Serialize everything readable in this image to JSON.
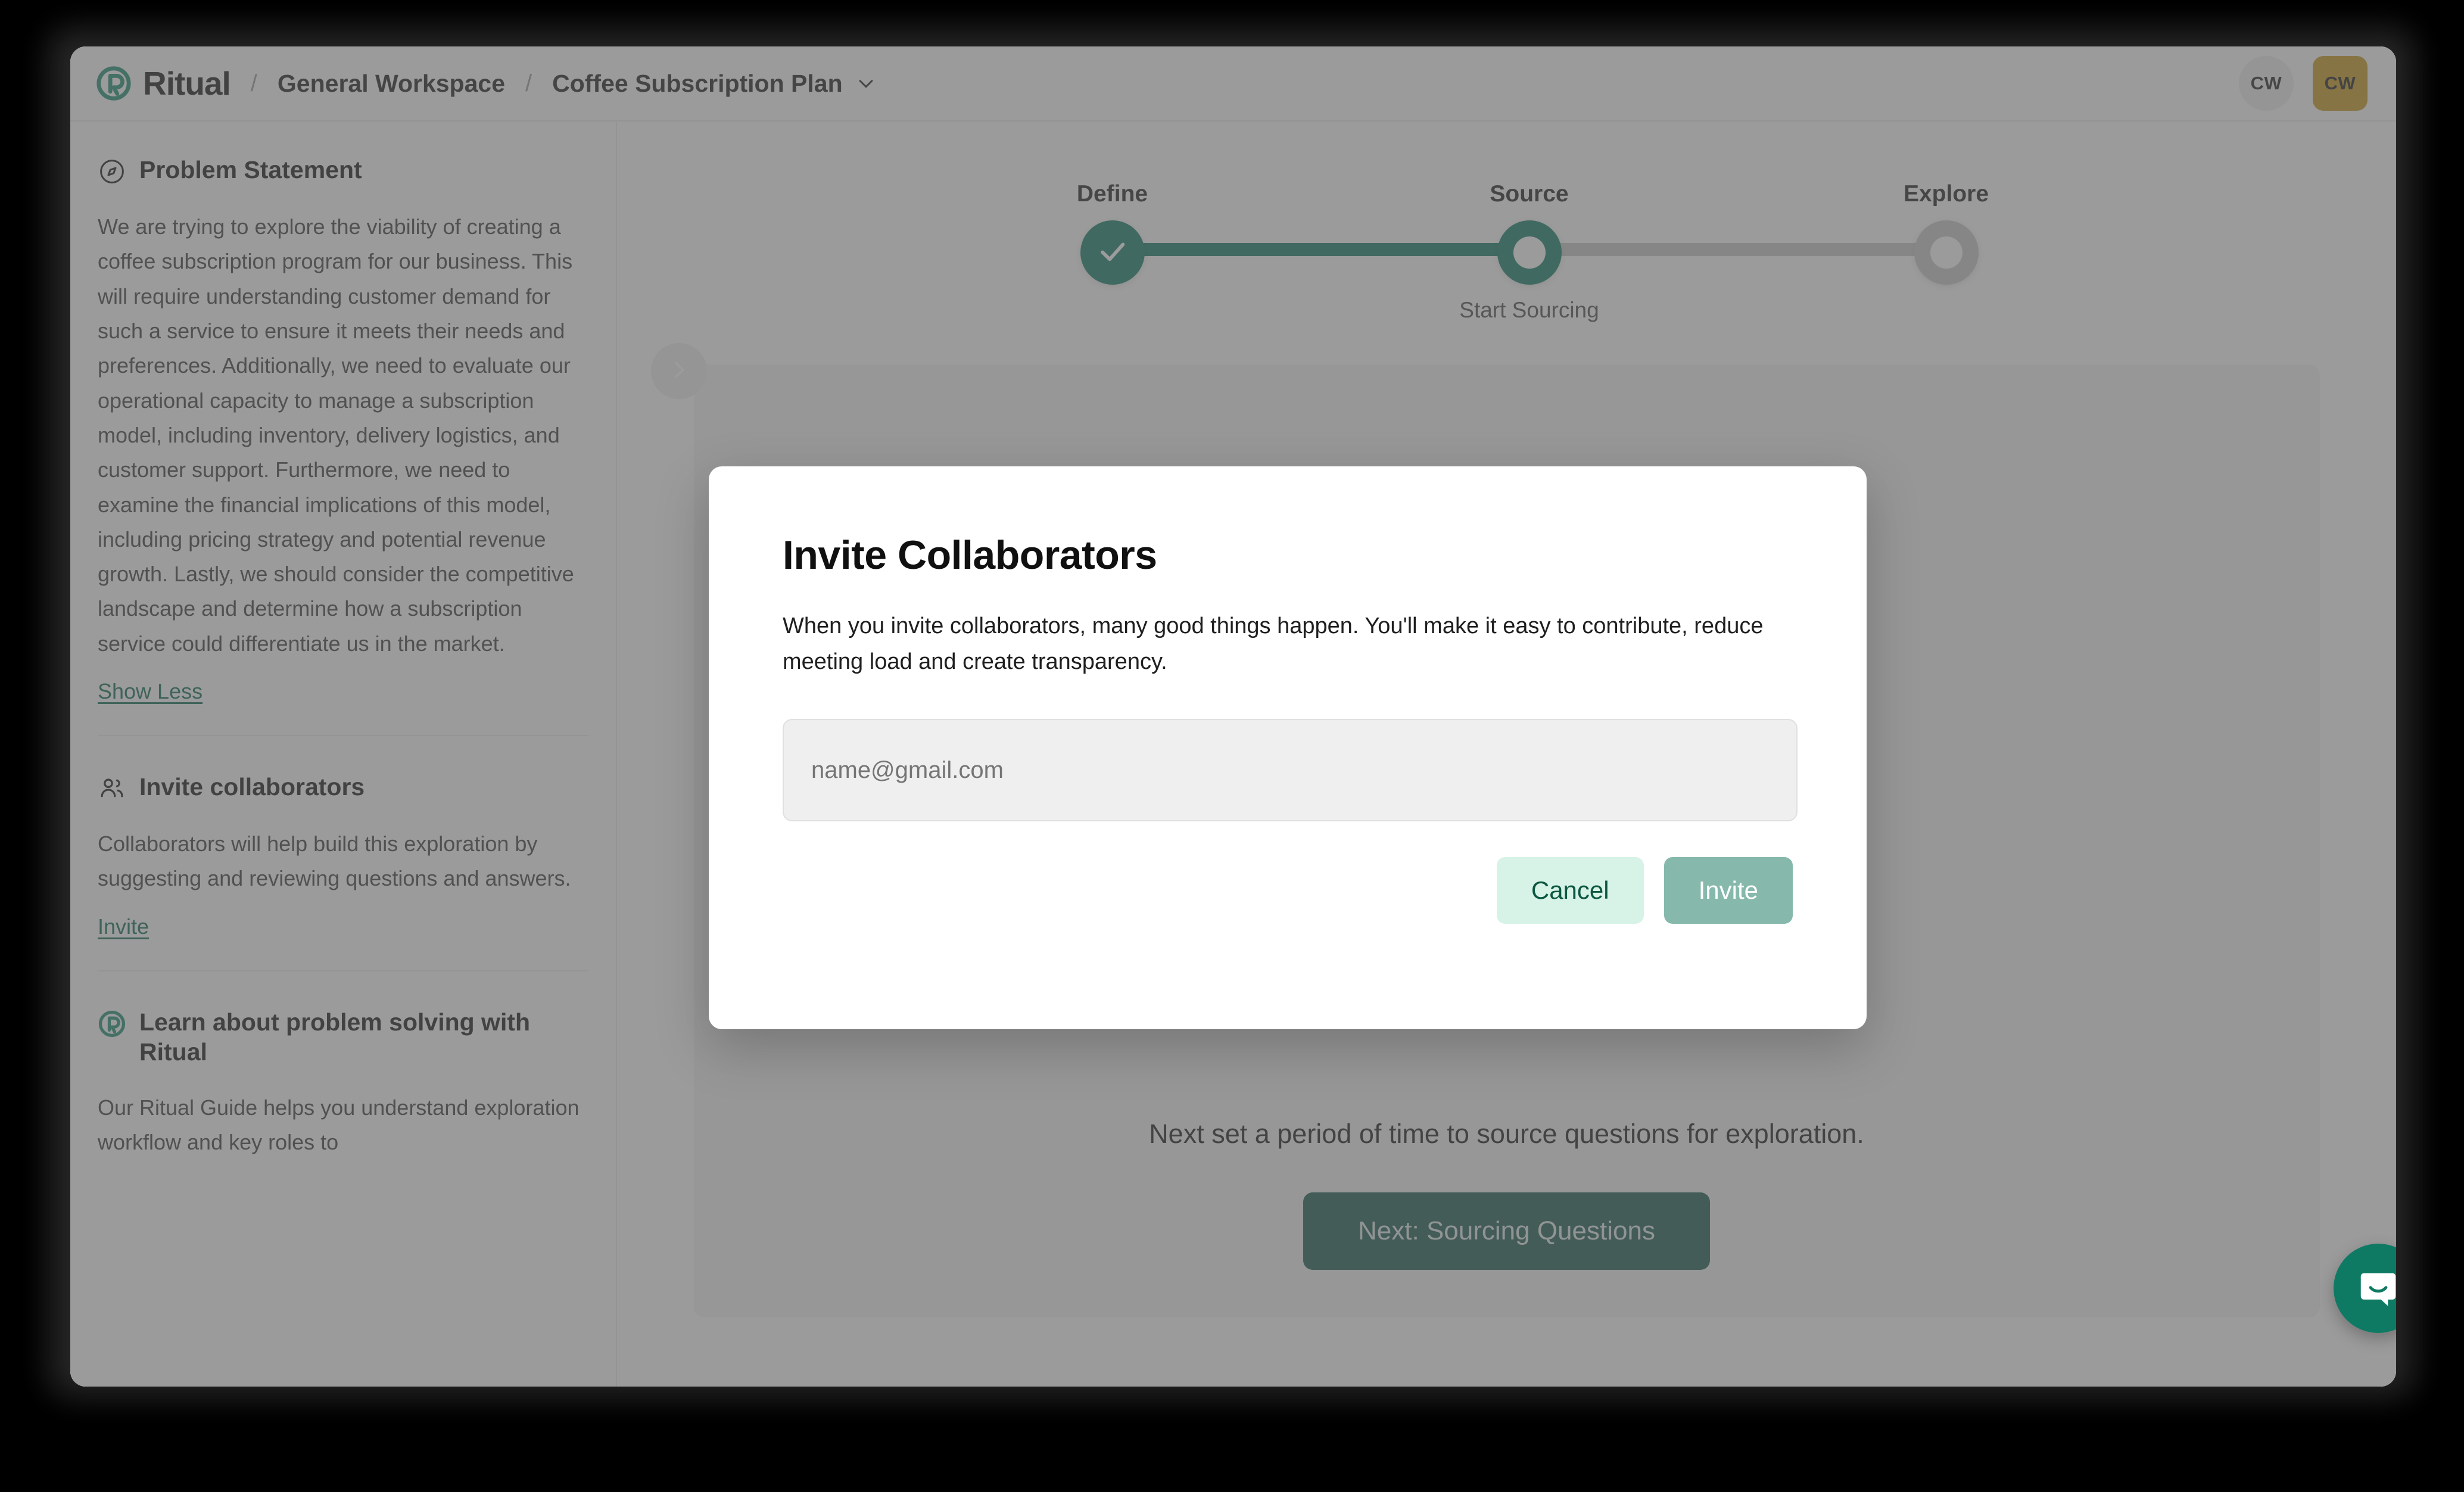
{
  "app": {
    "brand_name": "Ritual",
    "brand_logo_icon": "ritual-logo-icon"
  },
  "header": {
    "breadcrumb_separator": "/",
    "workspace": "General Workspace",
    "project": "Coffee Subscription Plan",
    "project_chevron_icon": "chevron-down-icon",
    "avatars": [
      {
        "initials": "CW",
        "shape": "circle",
        "color": "#ededed"
      },
      {
        "initials": "CW",
        "shape": "square",
        "color": "#c8971b"
      }
    ]
  },
  "sidebar": {
    "collapse_icon": "chevron-right-icon",
    "sections": [
      {
        "icon": "compass-icon",
        "title": "Problem Statement",
        "body": "We are trying to explore the viability of creating a coffee subscription program for our business. This will require understanding customer demand for such a service to ensure it meets their needs and preferences. Additionally, we need to evaluate our operational capacity to manage a subscription model, including inventory, delivery logistics, and customer support. Furthermore, we need to examine the financial implications of this model, including pricing strategy and potential revenue growth. Lastly, we should consider the competitive landscape and determine how a subscription service could differentiate us in the market.",
        "link": "Show Less"
      },
      {
        "icon": "users-icon",
        "title": "Invite collaborators",
        "body": "Collaborators will help build this exploration by suggesting and reviewing questions and answers.",
        "link": "Invite"
      },
      {
        "icon": "ritual-logo-icon",
        "title": "Learn about problem solving with Ritual",
        "body": "Our Ritual Guide helps you understand exploration workflow and key roles to",
        "link": ""
      }
    ]
  },
  "stepper": {
    "steps": [
      {
        "label": "Define",
        "state": "done",
        "sublabel": ""
      },
      {
        "label": "Source",
        "state": "current",
        "sublabel": "Start Sourcing"
      },
      {
        "label": "Explore",
        "state": "upcoming",
        "sublabel": ""
      }
    ],
    "check_icon": "check-icon",
    "active_color": "#0f7a64",
    "inactive_color": "#c6c6c6"
  },
  "main": {
    "caption": "Next set a period of time to source questions for exploration.",
    "next_button": "Next: Sourcing Questions",
    "next_button_color": "#17584c"
  },
  "modal": {
    "title": "Invite Collaborators",
    "description": "When you invite collaborators, many good things happen. You'll make it easy to contribute, reduce meeting load and create transparency.",
    "input_placeholder": "name@gmail.com",
    "input_value": "",
    "cancel_label": "Cancel",
    "invite_label": "Invite",
    "cancel_color": "#d7f2e7",
    "invite_color": "#86b9ab"
  },
  "support": {
    "launcher_icon": "intercom-chat-icon",
    "launcher_color": "#0f7a64"
  }
}
